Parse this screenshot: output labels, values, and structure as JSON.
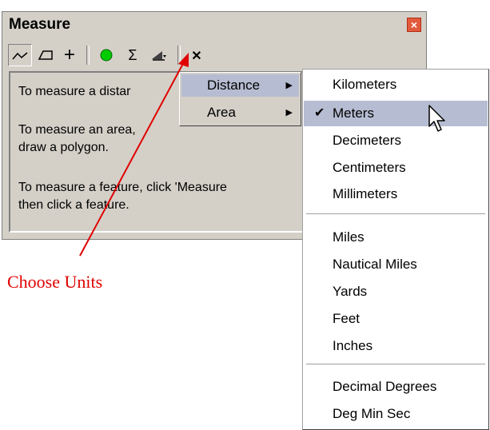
{
  "window": {
    "title": "Measure",
    "close_icon": "close-icon"
  },
  "toolbar": {
    "buttons": [
      {
        "icon": "measure-line-icon",
        "glyph": "〰"
      },
      {
        "icon": "measure-area-icon",
        "glyph": "⏢"
      },
      {
        "icon": "measure-feature-icon",
        "glyph": "+"
      },
      {
        "icon": "snap-to-feature-icon",
        "glyph": "●"
      },
      {
        "icon": "sum-icon",
        "glyph": "Σ"
      },
      {
        "icon": "choose-units-icon",
        "glyph": "▾"
      },
      {
        "icon": "clear-icon",
        "glyph": "✕"
      }
    ]
  },
  "panel": {
    "line1": "To measure a distar",
    "line2": "To measure an area,",
    "line3": "draw a polygon.",
    "line4": "To measure a feature, click 'Measure",
    "line5": "then click a feature."
  },
  "menu": {
    "items": [
      {
        "label": "Distance",
        "selected": true
      },
      {
        "label": "Area",
        "selected": false
      }
    ]
  },
  "units_menu": {
    "group1": [
      "Kilometers",
      "Meters",
      "Decimeters",
      "Centimeters",
      "Millimeters"
    ],
    "group2": [
      "Miles",
      "Nautical Miles",
      "Yards",
      "Feet",
      "Inches"
    ],
    "group3": [
      "Decimal Degrees",
      "Deg Min Sec"
    ],
    "checked": "Meters",
    "check_glyph": "✔"
  },
  "annotation": {
    "label": "Choose Units",
    "color": "#e00000"
  },
  "colors": {
    "window_bg": "#d4d0c8",
    "menu_highlight": "#b6bdd2",
    "close_button": "#e25a3c",
    "snap_green": "#00cc00"
  }
}
